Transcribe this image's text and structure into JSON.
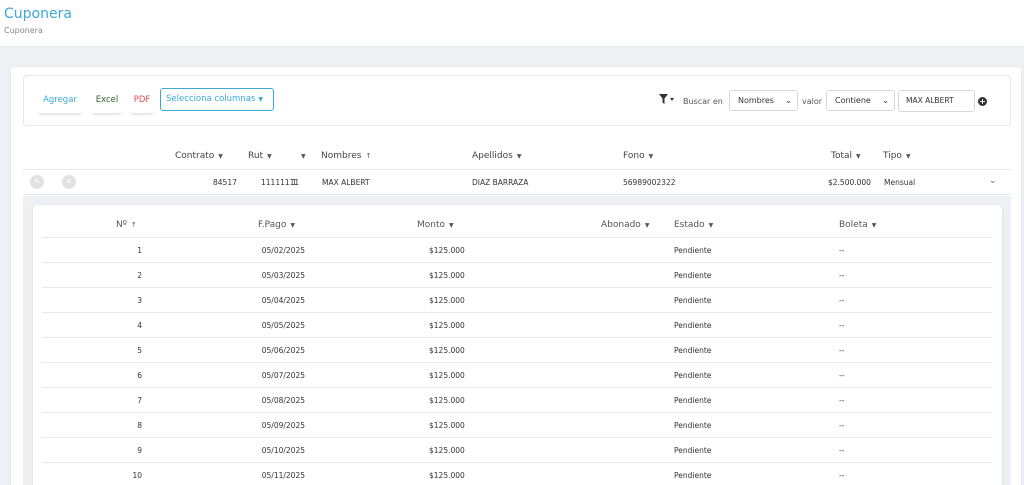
{
  "header": {
    "title": "Cuponera",
    "breadcrumb": "Cuponera"
  },
  "toolbar": {
    "agregar": "Agregar",
    "excel": "Excel",
    "pdf": "PDF",
    "columns": "Selecciona columnas",
    "search_label": "Buscar en",
    "search_field": "Nombres",
    "value_label": "valor",
    "operator": "Contiene",
    "search_value": "MAX ALBERT"
  },
  "main_table": {
    "columns": [
      "Contrato",
      "Rut",
      "Nombres",
      "Apellidos",
      "Fono",
      "Total",
      "Tipo"
    ],
    "row": {
      "contrato": "84517",
      "rut": "11111111",
      "dv": "1",
      "nombres": "MAX ALBERT",
      "apellidos": "DIAZ BARRAZA",
      "fono": "56989002322",
      "total": "$2.500.000",
      "tipo": "Mensual"
    }
  },
  "sub_table": {
    "columns": [
      "Nº",
      "F.Pago",
      "Monto",
      "Abonado",
      "Estado",
      "Boleta"
    ],
    "rows": [
      {
        "n": "1",
        "fecha": "05/02/2025",
        "monto": "$125.000",
        "estado": "Pendiente",
        "boleta": "--"
      },
      {
        "n": "2",
        "fecha": "05/03/2025",
        "monto": "$125.000",
        "estado": "Pendiente",
        "boleta": "--"
      },
      {
        "n": "3",
        "fecha": "05/04/2025",
        "monto": "$125.000",
        "estado": "Pendiente",
        "boleta": "--"
      },
      {
        "n": "4",
        "fecha": "05/05/2025",
        "monto": "$125.000",
        "estado": "Pendiente",
        "boleta": "--"
      },
      {
        "n": "5",
        "fecha": "05/06/2025",
        "monto": "$125.000",
        "estado": "Pendiente",
        "boleta": "--"
      },
      {
        "n": "6",
        "fecha": "05/07/2025",
        "monto": "$125.000",
        "estado": "Pendiente",
        "boleta": "--"
      },
      {
        "n": "7",
        "fecha": "05/08/2025",
        "monto": "$125.000",
        "estado": "Pendiente",
        "boleta": "--"
      },
      {
        "n": "8",
        "fecha": "05/09/2025",
        "monto": "$125.000",
        "estado": "Pendiente",
        "boleta": "--"
      },
      {
        "n": "9",
        "fecha": "05/10/2025",
        "monto": "$125.000",
        "estado": "Pendiente",
        "boleta": "--"
      },
      {
        "n": "10",
        "fecha": "05/11/2025",
        "monto": "$125.000",
        "estado": "Pendiente",
        "boleta": "--"
      }
    ]
  },
  "icons": {
    "edit": "pencil-icon",
    "cancel": "close-icon",
    "filter": "filter-icon",
    "add": "plus-circle-icon",
    "expand": "chevron-down-icon"
  },
  "colors": {
    "accent": "#3aa9d8",
    "excel": "#2e5e2e",
    "pdf": "#e04c4c"
  }
}
